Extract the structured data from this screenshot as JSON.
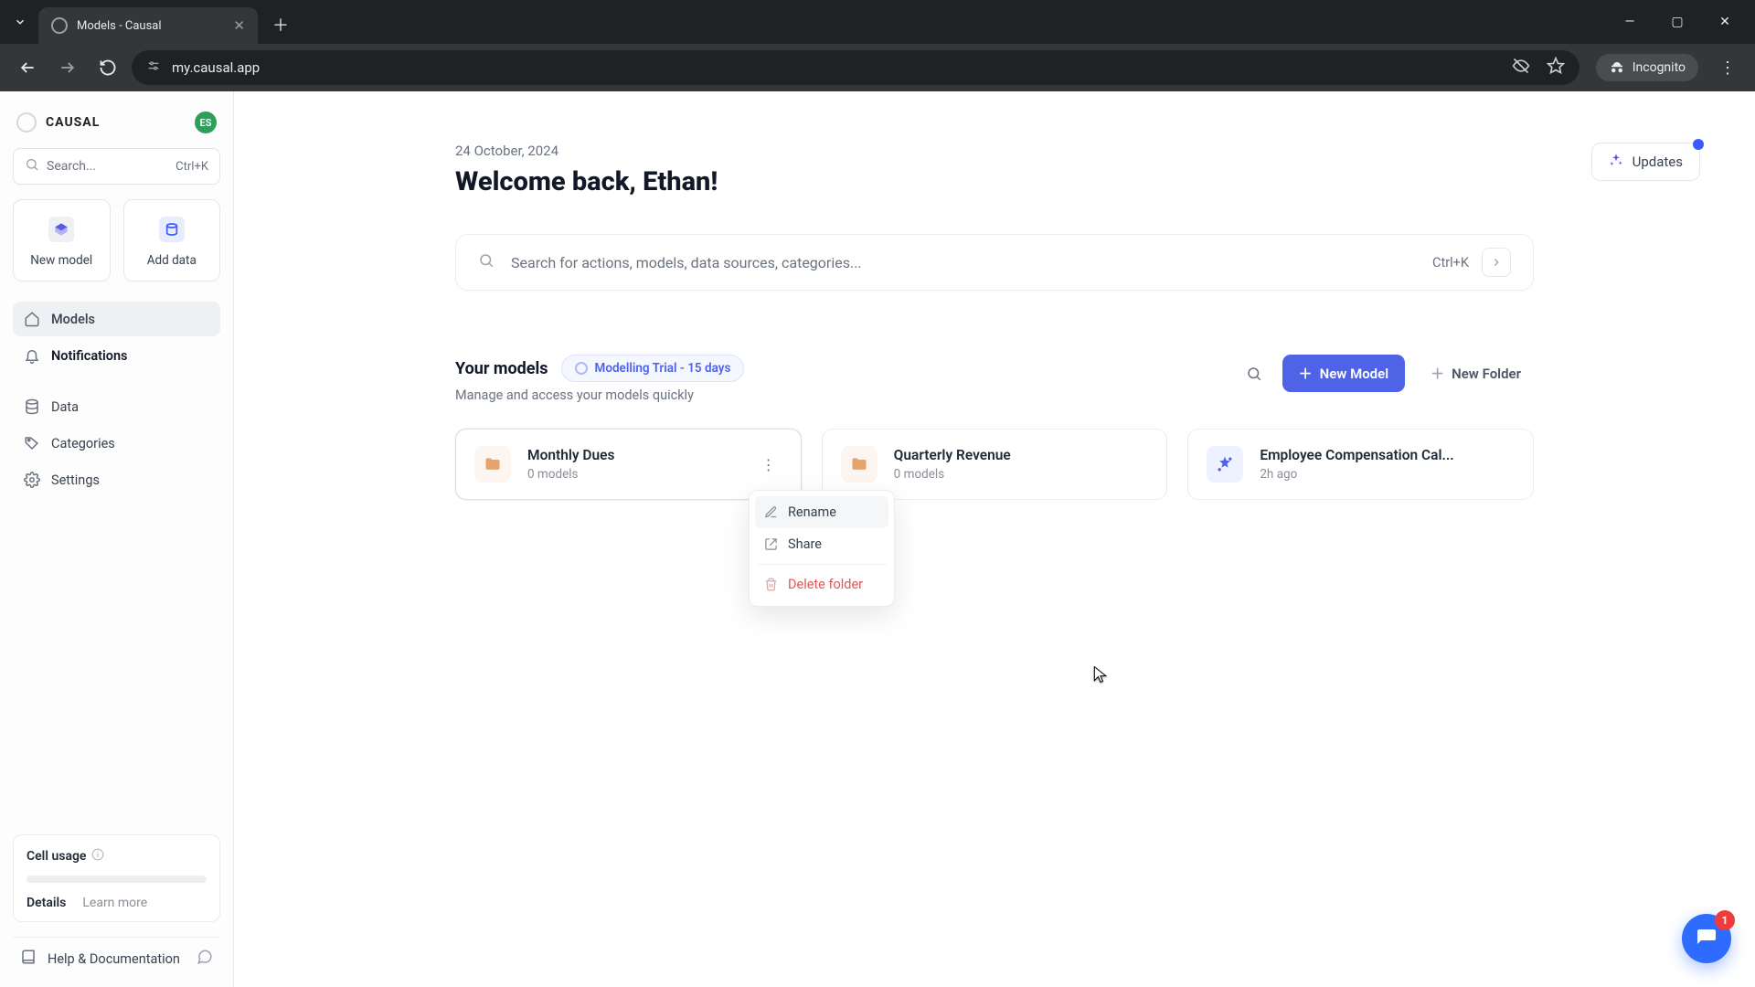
{
  "browser": {
    "tab_title": "Models - Causal",
    "url": "my.causal.app",
    "incognito_label": "Incognito"
  },
  "sidebar": {
    "brand": "CAUSAL",
    "avatar_initials": "ES",
    "search_placeholder": "Search...",
    "search_shortcut": "Ctrl+K",
    "quick": {
      "new_model": "New model",
      "add_data": "Add data"
    },
    "nav": {
      "models": "Models",
      "notifications": "Notifications",
      "data": "Data",
      "categories": "Categories",
      "settings": "Settings"
    },
    "usage": {
      "title": "Cell usage",
      "details": "Details",
      "learn": "Learn more"
    },
    "help": "Help & Documentation"
  },
  "main": {
    "date": "24 October, 2024",
    "welcome": "Welcome back, Ethan!",
    "updates": "Updates",
    "search_placeholder": "Search for actions, models, data sources, categories...",
    "search_shortcut": "Ctrl+K",
    "section_title": "Your models",
    "trial_badge": "Modelling Trial - 15 days",
    "section_sub": "Manage and access your models quickly",
    "new_model_btn": "New Model",
    "new_folder_btn": "New Folder",
    "cards": [
      {
        "type": "folder",
        "title": "Monthly Dues",
        "sub": "0 models"
      },
      {
        "type": "folder",
        "title": "Quarterly Revenue",
        "sub": "0 models"
      },
      {
        "type": "model",
        "title": "Employee Compensation Cal...",
        "sub": "2h ago"
      }
    ],
    "context_menu": {
      "rename": "Rename",
      "share": "Share",
      "delete": "Delete folder"
    },
    "chat_badge": "1"
  }
}
